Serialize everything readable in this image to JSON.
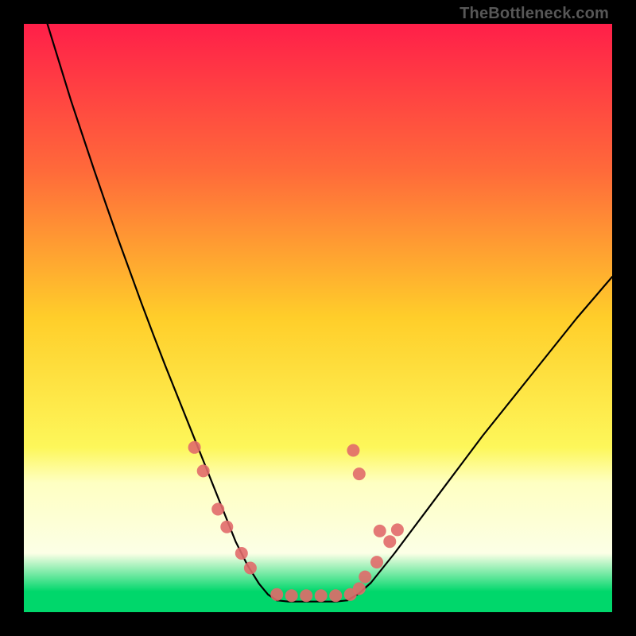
{
  "watermark": "TheBottleneck.com",
  "chart_data": {
    "type": "line",
    "title": "",
    "xlabel": "",
    "ylabel": "",
    "xlim": [
      0,
      100
    ],
    "ylim": [
      0,
      100
    ],
    "grid": false,
    "legend": false,
    "background_gradient_stops": [
      {
        "offset": 0.0,
        "color": "#ff1f49"
      },
      {
        "offset": 0.25,
        "color": "#ff6a3a"
      },
      {
        "offset": 0.5,
        "color": "#ffce2a"
      },
      {
        "offset": 0.72,
        "color": "#fdf75a"
      },
      {
        "offset": 0.78,
        "color": "#feffc2"
      },
      {
        "offset": 0.9,
        "color": "#fcffe6"
      },
      {
        "offset": 0.965,
        "color": "#00d76b"
      },
      {
        "offset": 1.0,
        "color": "#00d76b"
      }
    ],
    "series": [
      {
        "name": "left-arm",
        "color": "#000000",
        "x": [
          4.0,
          6.0,
          8.0,
          10.0,
          12.0,
          14.0,
          16.0,
          18.0,
          20.0,
          22.0,
          24.0,
          26.0,
          28.0,
          30.0,
          32.0,
          34.0,
          36.0,
          38.0,
          40.0,
          41.5,
          43.0
        ],
        "y": [
          100.0,
          93.5,
          87.0,
          81.0,
          75.0,
          69.2,
          63.5,
          58.0,
          52.5,
          47.2,
          42.0,
          37.0,
          32.0,
          27.0,
          22.0,
          17.0,
          12.0,
          8.0,
          4.8,
          3.0,
          2.0
        ]
      },
      {
        "name": "floor",
        "color": "#000000",
        "x": [
          43.0,
          45.0,
          47.0,
          49.0,
          51.0,
          53.0,
          55.0
        ],
        "y": [
          2.0,
          1.8,
          1.8,
          1.8,
          1.8,
          1.8,
          2.0
        ]
      },
      {
        "name": "right-arm",
        "color": "#000000",
        "x": [
          55.0,
          57.0,
          59.0,
          61.0,
          63.0,
          66.0,
          69.0,
          72.0,
          75.0,
          78.0,
          82.0,
          86.0,
          90.0,
          94.0,
          97.0,
          100.0
        ],
        "y": [
          2.0,
          3.2,
          5.0,
          7.5,
          10.0,
          14.0,
          18.0,
          22.0,
          26.0,
          30.0,
          35.0,
          40.0,
          45.0,
          50.0,
          53.5,
          57.0
        ]
      }
    ],
    "markers": {
      "name": "dot-overlay",
      "color": "#e16a6a",
      "alpha": 0.9,
      "radius": 8,
      "points": [
        {
          "x": 29.0,
          "y": 28.0
        },
        {
          "x": 30.5,
          "y": 24.0
        },
        {
          "x": 33.0,
          "y": 17.5
        },
        {
          "x": 34.5,
          "y": 14.5
        },
        {
          "x": 37.0,
          "y": 10.0
        },
        {
          "x": 38.5,
          "y": 7.5
        },
        {
          "x": 43.0,
          "y": 3.0
        },
        {
          "x": 45.5,
          "y": 2.8
        },
        {
          "x": 48.0,
          "y": 2.8
        },
        {
          "x": 50.5,
          "y": 2.8
        },
        {
          "x": 53.0,
          "y": 2.8
        },
        {
          "x": 55.5,
          "y": 3.0
        },
        {
          "x": 57.0,
          "y": 4.0
        },
        {
          "x": 58.0,
          "y": 6.0
        },
        {
          "x": 60.0,
          "y": 8.5
        },
        {
          "x": 62.2,
          "y": 12.0
        },
        {
          "x": 60.5,
          "y": 13.8
        },
        {
          "x": 63.5,
          "y": 14.0
        },
        {
          "x": 57.0,
          "y": 23.5
        },
        {
          "x": 56.0,
          "y": 27.5
        }
      ]
    }
  }
}
